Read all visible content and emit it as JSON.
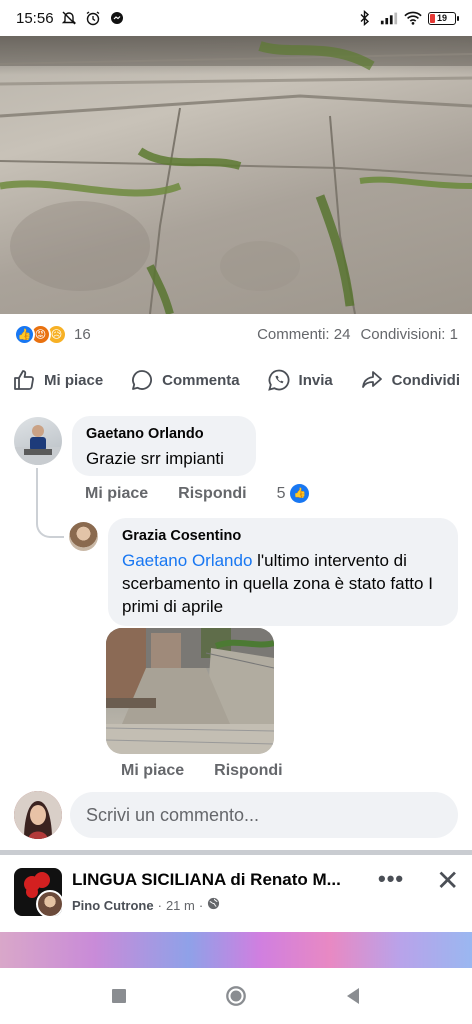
{
  "status_bar": {
    "time": "15:56",
    "battery": "19",
    "icons": [
      "mute-icon",
      "alarm-icon",
      "chat-head-icon",
      "bluetooth-icon",
      "signal-icon",
      "wifi-icon",
      "battery-icon"
    ]
  },
  "post": {
    "photo_icon": "stone-steps-photo",
    "reactions": {
      "icons": [
        "like",
        "angry",
        "sad"
      ],
      "count": "16",
      "comments": "Commenti: 24",
      "shares": "Condivisioni: 1"
    },
    "actions": {
      "like": "Mi piace",
      "comment": "Commenta",
      "send": "Invia",
      "share": "Condividi"
    }
  },
  "comments": [
    {
      "author": "Gaetano Orlando",
      "text": "Grazie srr impianti",
      "like_label": "Mi piace",
      "reply_label": "Rispondi",
      "like_count": "5"
    },
    {
      "author": "Grazia Cosentino",
      "mention": "Gaetano Orlando",
      "text": " l'ultimo intervento di scerbamento in quella zona è stato fatto I primi di aprile",
      "like_label": "Mi piace",
      "reply_label": "Rispondi"
    }
  ],
  "composer": {
    "placeholder": "Scrivi un commento..."
  },
  "next_post": {
    "group_name": "LINGUA SICILIANA di Renato M...",
    "poster": "Pino Cutrone",
    "time": "21 m",
    "more": "•••",
    "close": "✕"
  },
  "colors": {
    "accent": "#1877f2",
    "bubble": "#f0f2f5",
    "muted_text": "#65676b"
  }
}
